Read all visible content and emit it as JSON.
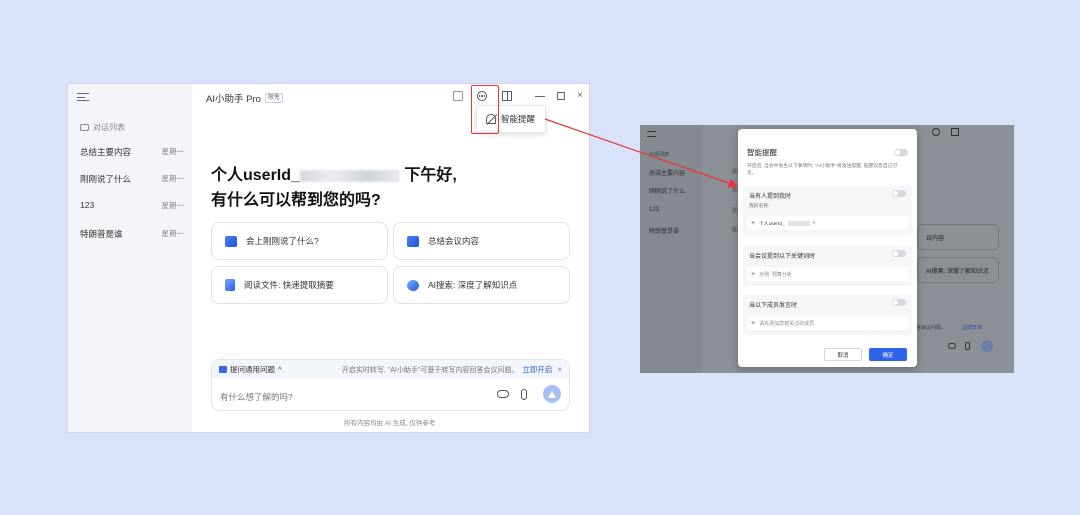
{
  "window": {
    "title": "AI小助手 Pro",
    "badge": "限免"
  },
  "sidebar": {
    "header": "对话列表",
    "items": [
      {
        "label": "总结主要内容",
        "date": "星期一"
      },
      {
        "label": "刚刚说了什么",
        "date": "星期一"
      },
      {
        "label": "123",
        "date": "星期一"
      },
      {
        "label": "特朗普是谁",
        "date": "星期一"
      }
    ]
  },
  "popup": {
    "label": "智能提醒"
  },
  "greeting": {
    "line1_prefix": "个人userId_",
    "line1_suffix": "下午好,",
    "line2": "有什么可以帮到您的吗?"
  },
  "cards": [
    {
      "label": "会上刚刚说了什么?"
    },
    {
      "label": "总结会议内容"
    },
    {
      "label": "阅读文件: 快速提取摘要"
    },
    {
      "label": "AI搜索: 深度了解知识点"
    }
  ],
  "input": {
    "quick_label": "提问通用问题",
    "tip": "开启实时转写, \"AI小助手\"可基于转写内容回答会议问题。",
    "tip_link": "立即开启",
    "placeholder": "有什么想了解的吗?"
  },
  "footer": "所有内容均由 AI 生成, 仅供参考",
  "shot": {
    "sidebar_header": "对话列表",
    "items": [
      {
        "label": "总结主要内容",
        "date": "星期一"
      },
      {
        "label": "刚刚说了什么",
        "date": "星期一"
      },
      {
        "label": "123",
        "date": "星期一"
      },
      {
        "label": "特朗普是谁",
        "date": "星期一"
      }
    ],
    "card1": "议内容",
    "card2": "AI搜索: 深度了解知识点",
    "bottom_dim": "可基于转写内容回答会议问题。",
    "bottom_link": "立即开启",
    "dialog": {
      "title": "智能提醒",
      "desc": "开启后, 当会中发生以下事项时, \"AI小助手\"将发送提醒, 提醒仅您自己可见。",
      "sections": [
        {
          "header": "当有人提到我时",
          "sub": "我的名称:",
          "field": "个人userId_"
        },
        {
          "header": "当会议提到以下关键词时",
          "field": "示例: 预算分析"
        },
        {
          "header": "当以下成员发言时",
          "field": "请先添加您想关注的成员"
        }
      ],
      "cancel": "取消",
      "ok": "确定"
    }
  }
}
